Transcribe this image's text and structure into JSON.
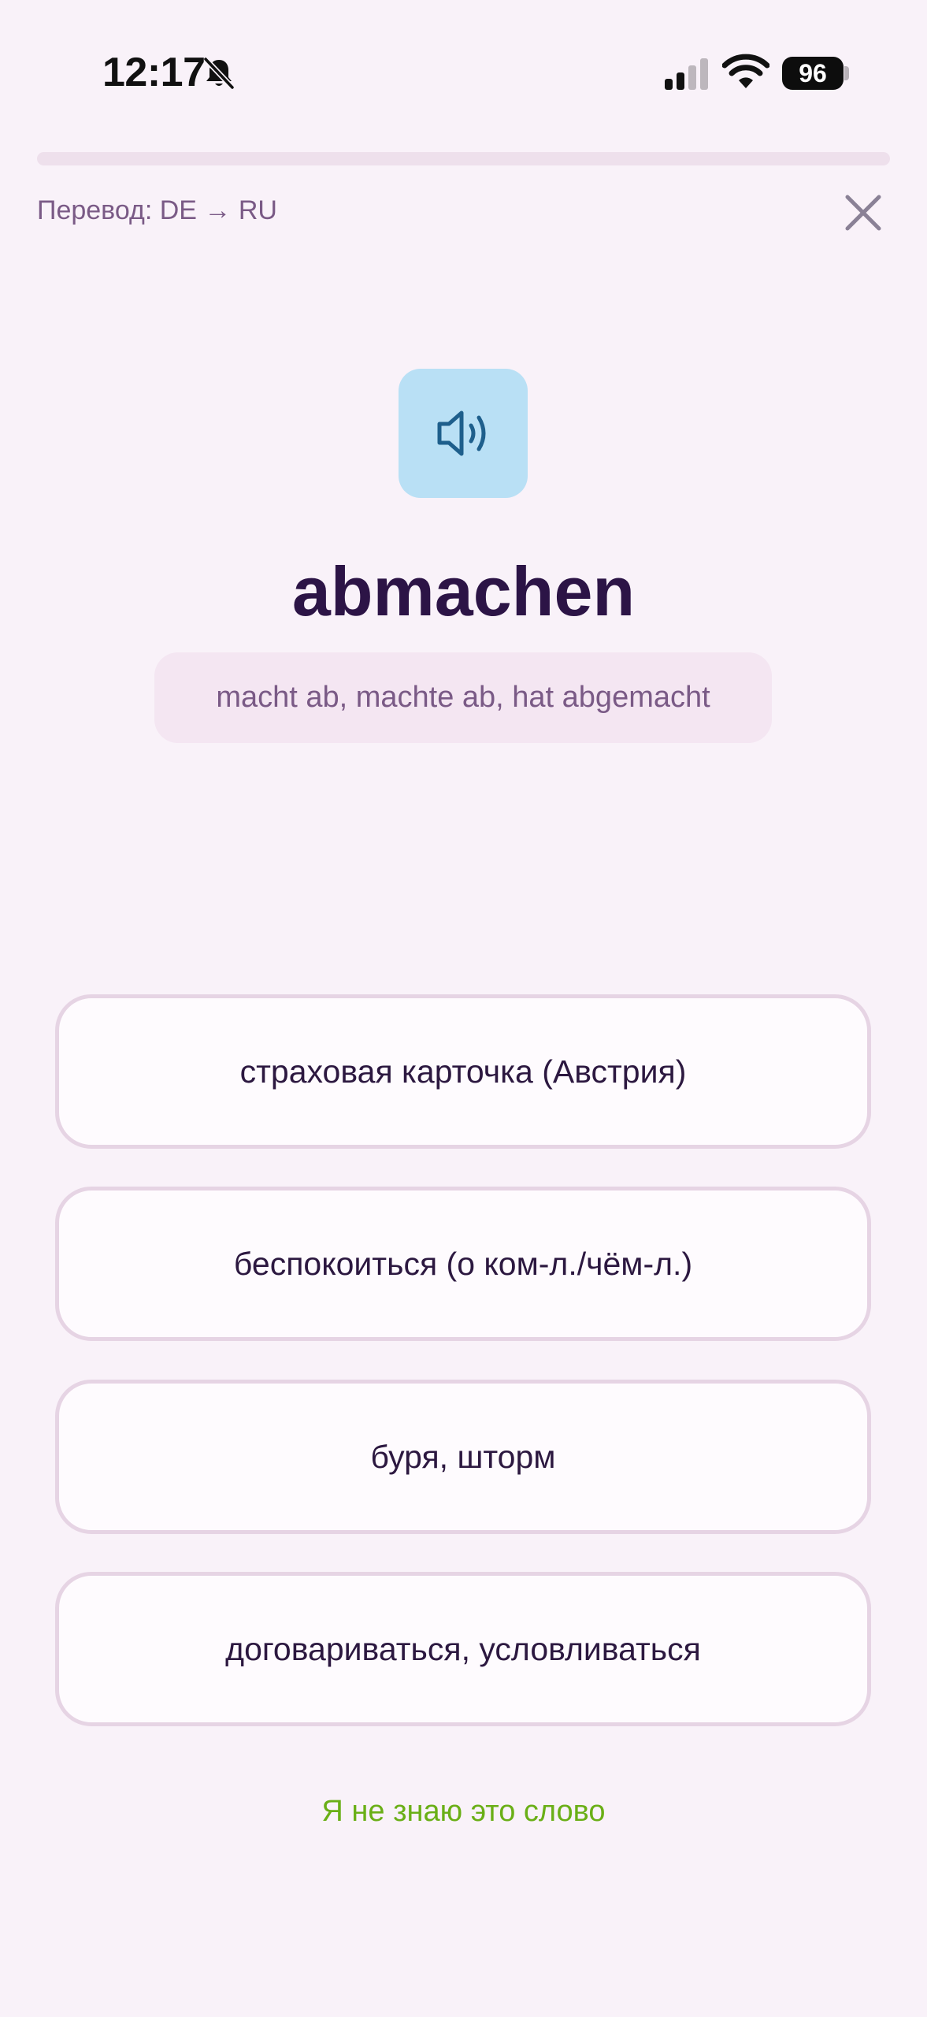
{
  "status_bar": {
    "time": "12:17",
    "battery": "96",
    "icons": [
      "bell-muted-icon",
      "cellular-signal-icon",
      "wifi-icon",
      "battery-icon"
    ]
  },
  "progress": {
    "fraction": 0
  },
  "header": {
    "mode_label": "Перевод: DE → RU",
    "close_icon": "close-icon"
  },
  "card": {
    "audio_icon": "speaker-icon",
    "word": "abmachen",
    "forms": "macht ab, machte ab, hat abgemacht"
  },
  "options": [
    {
      "label": "страховая карточка (Австрия)"
    },
    {
      "label": "беспокоиться (о ком-л./чём-л.)"
    },
    {
      "label": "буря, шторм"
    },
    {
      "label": "договариваться, условливаться"
    }
  ],
  "footer": {
    "dont_know_label": "Я не знаю это слово"
  },
  "colors": {
    "background": "#f9f2f9",
    "accent_green": "#6aaf17",
    "audio_bg": "#b9e0f5",
    "word_color": "#2c1446"
  }
}
